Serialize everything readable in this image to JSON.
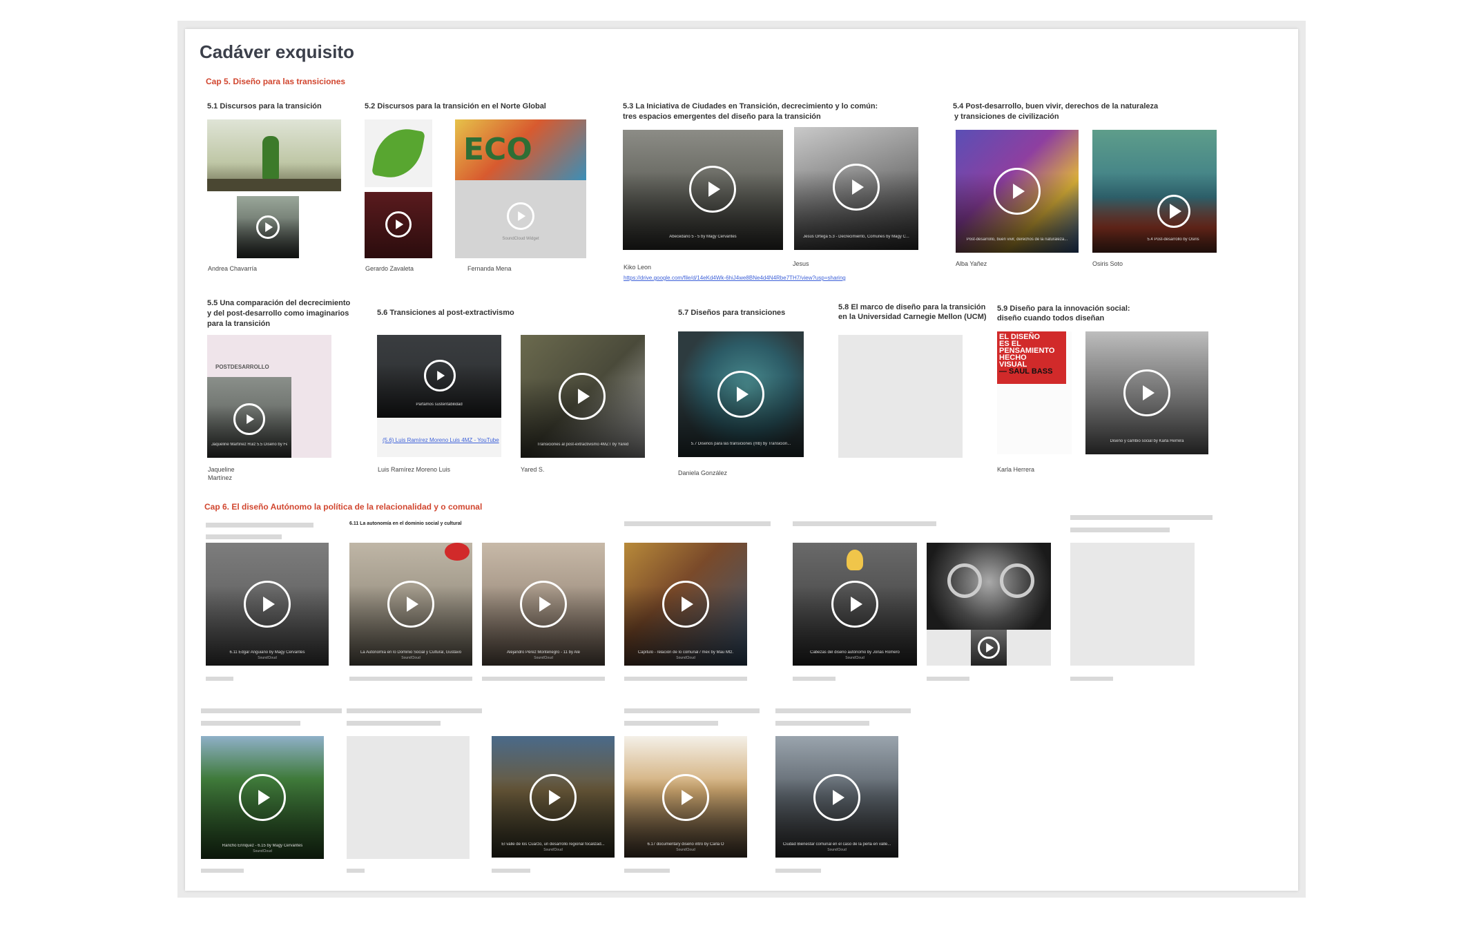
{
  "page_title": "Cadáver exquisito",
  "chapter5": {
    "heading": "Cap 5. Diseño para las transiciones",
    "sections": [
      {
        "title_lines": [
          "5.1 Discursos para la transición"
        ],
        "authors": [
          "Andrea Chavarría"
        ]
      },
      {
        "title_lines": [
          "5.2 Discursos para la transición en el Norte Global"
        ],
        "authors": [
          "Gerardo Zavaleta",
          "Fernanda Mena"
        ],
        "soundcloud_label": "SoundCloud Widget"
      },
      {
        "title_lines": [
          "5.3 La Iniciativa de Ciudades en Transición, decrecimiento y lo común:",
          "tres espacios emergentes del diseño para la  transición"
        ],
        "authors": [
          "Kiko Leon",
          "Jesus"
        ],
        "link": "https://drive.google.com/file/d/14eKd4Wk-6hiJ4we8BNe4d4N4Rbe7TH7/view?usp=sharing",
        "video_captions": [
          "Abecedario 5 - 5 by Magy Cervantes",
          "Jesús Ortega 5.3 - Decrecimiento, Comunes by Magy C..."
        ]
      },
      {
        "title_lines": [
          "5.4 Post-desarrollo, buen vivir, derechos de la naturaleza",
          "y transiciones de civilización"
        ],
        "authors": [
          "Alba Yañez",
          "Osiris Soto"
        ],
        "video_captions": [
          "Post-desarrollo, buen vivir, derechos de la naturaleza...",
          "5.4 Post-desarrollo by Osiris"
        ]
      },
      {
        "title_lines": [
          "5.5 Una comparación del decrecimiento",
          "y del post-desarrollo como imaginarios",
          "para la transición"
        ],
        "authors": [
          "Jaqueline",
          "Martínez"
        ],
        "slide_label": "POSTDESARROLLO",
        "video_captions": [
          "Jaqueline Martínez Ruiz 5.5 Diseño by Fernanda"
        ]
      },
      {
        "title_lines": [
          "5.6 Transiciones al post-extractivismo"
        ],
        "authors": [
          "Luis Ramírez Moreno Luis",
          "Yared S."
        ],
        "link": "(5.6) Luis Ramírez Moreno Luis 4MZ - YouTube",
        "video_captions": [
          "Partamos sustentabilidad",
          "Transiciones al post-extractivismo 4MZT by Yared"
        ]
      },
      {
        "title_lines": [
          "5.7 Diseños para transiciones"
        ],
        "authors": [
          "Daniela González"
        ],
        "video_captions": [
          "5.7 Diseños para las transiciones (mb) by Transicion..."
        ]
      },
      {
        "title_lines": [
          "5.8 El marco de diseño para la transición",
          "en la Universidad Carnegie Mellon (UCM)"
        ],
        "authors": []
      },
      {
        "title_lines": [
          "5.9 Diseño para la innovación social:",
          "diseño cuando todos diseñan"
        ],
        "authors": [
          "Karla Herrera"
        ],
        "book_lines": [
          "EL DISEÑO",
          "ES EL",
          "PENSAMIENTO",
          "HECHO",
          "VISUAL",
          "— SAUL BASS"
        ],
        "video_captions": [
          "Diseño y cambio social by Karla Herrera"
        ]
      }
    ]
  },
  "chapter6": {
    "heading": "Cap 6. El diseño Autónomo la política de la relacionalidad y o comunal",
    "subsection": "6.11 La autonomía en el dominio social y cultural",
    "video_captions": [
      "6.11 Edgar Anguiano by Magy Cervantes",
      "La Autonomía en lo Dominio Social y Cultural, Gustavo",
      "Alejandro Pérez Montenegro - 11 by Ale",
      "Capítulo - relación de lo comunal / mex by Mau Mtz.",
      "Cabezas del diseño autónomo by Jonás Romero",
      "Rancho Enriquez - 6.15 by Magy Cervantes",
      "El valle de los Cuarzo, un desarrollo regional focalizad...",
      "6.17 documentary diseño intro by Carla O",
      "Ciudad Bienestar comunal en el caso de la perla en valle..."
    ],
    "source_label": "SoundCloud"
  },
  "colors": {
    "accent": "#d1462f",
    "link": "#3b5fd8",
    "placeholder": "#e8e8e8",
    "board": "#ffffff"
  },
  "icons": [
    "play-icon"
  ]
}
